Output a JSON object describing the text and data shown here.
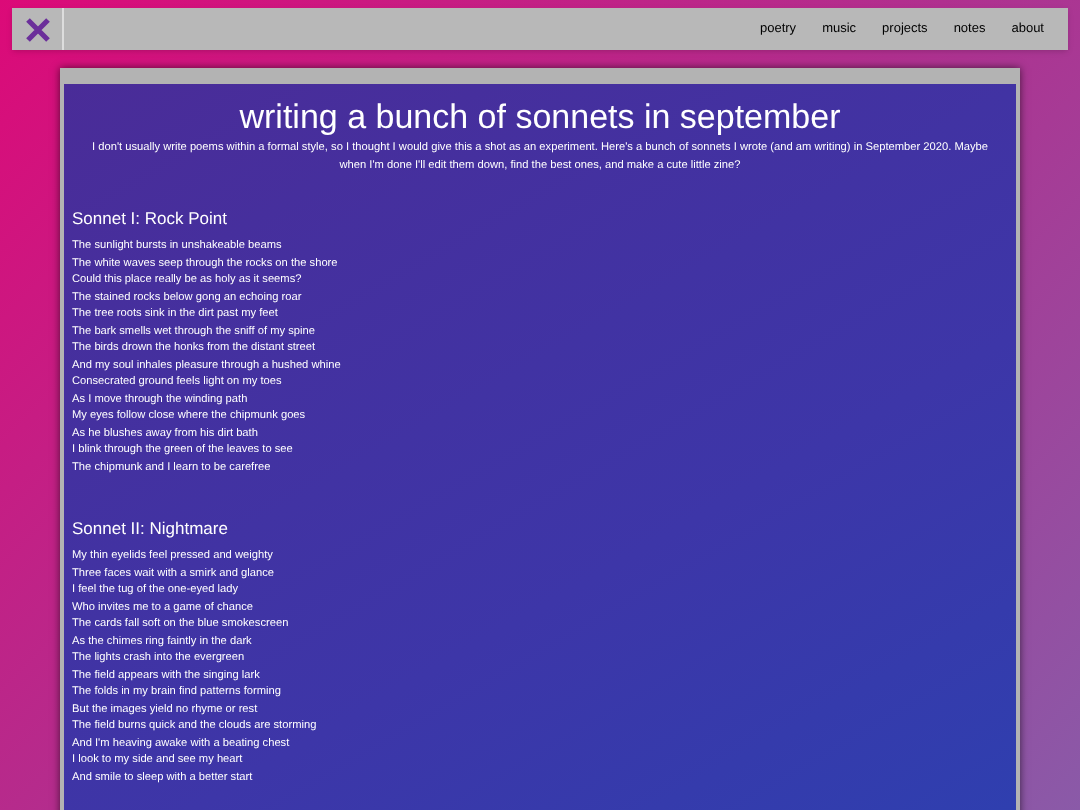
{
  "nav": {
    "links": [
      "poetry",
      "music",
      "projects",
      "notes",
      "about"
    ]
  },
  "article": {
    "title": "writing a bunch of sonnets in september",
    "intro": "I don't usually write poems within a formal style, so I thought I would give this a shot as an experiment. Here's a bunch of sonnets I wrote (and am writing) in September 2020. Maybe when I'm done I'll edit them down, find the best ones, and make a cute little zine?",
    "sonnets": [
      {
        "title": "Sonnet I: Rock Point",
        "lines": [
          "The sunlight bursts in unshakeable beams",
          "The white waves seep through the rocks on the shore",
          "Could this place really be as holy as it seems?",
          "The stained rocks below gong an echoing roar",
          "The tree roots sink in the dirt past my feet",
          "The bark smells wet through the sniff of my spine",
          "The birds drown the honks from the distant street",
          "And my soul inhales pleasure through a hushed whine",
          "Consecrated ground feels light on my toes",
          "As I move through the winding path",
          "My eyes follow close where the chipmunk goes",
          "As he blushes away from his dirt bath",
          "I blink through the green of the leaves to see",
          "The chipmunk and I learn to be carefree"
        ]
      },
      {
        "title": "Sonnet II: Nightmare",
        "lines": [
          "My thin eyelids feel pressed and weighty",
          "Three faces wait with a smirk and glance",
          "I feel the tug of the one-eyed lady",
          "Who invites me to a game of chance",
          "The cards fall soft on the blue smokescreen",
          "As the chimes ring faintly in the dark",
          "The lights crash into the evergreen",
          "The field appears with the singing lark",
          "The folds in my brain find patterns forming",
          "But the images yield no rhyme or rest",
          "The field burns quick and the clouds are storming",
          "And I'm heaving awake with a beating chest",
          "I look to my side and see my heart",
          "And smile to sleep with a better start"
        ]
      }
    ]
  }
}
